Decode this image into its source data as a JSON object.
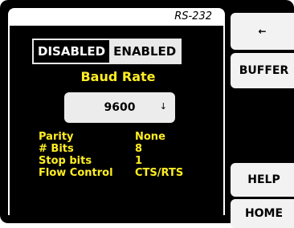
{
  "panel": {
    "title": "RS-232",
    "toggle": {
      "disabled_label": "DISABLED",
      "enabled_label": "ENABLED",
      "selected": "DISABLED"
    },
    "baud": {
      "label": "Baud Rate",
      "value": "9600",
      "chevron_icon": "chevron-down-icon"
    },
    "properties": [
      {
        "key": "Parity",
        "value": "None"
      },
      {
        "key": "# Bits",
        "value": "8"
      },
      {
        "key": "Stop bits",
        "value": "1"
      },
      {
        "key": "Flow Control",
        "value": "CTS/RTS"
      }
    ]
  },
  "sidebar": {
    "back_icon": "left-arrow-icon",
    "back_glyph": "←",
    "buffer_label": "BUFFER",
    "help_label": "HELP",
    "home_label": "HOME"
  },
  "colors": {
    "accent": "#ffee22",
    "background": "#000000",
    "button": "#f2f2f2"
  }
}
